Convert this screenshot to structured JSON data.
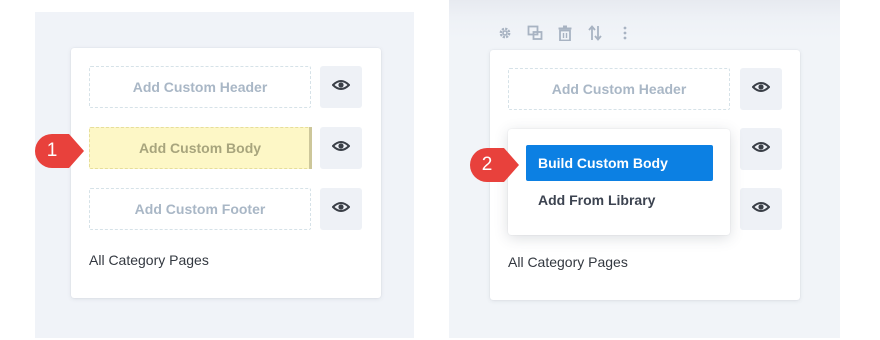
{
  "left": {
    "slots": {
      "header": "Add Custom Header",
      "body": "Add Custom Body",
      "footer": "Add Custom Footer"
    },
    "footer_label": "All Category Pages",
    "step_badge": "1"
  },
  "right": {
    "toolbar_icons": [
      "gear-icon",
      "duplicate-icon",
      "trash-icon",
      "sort-icon",
      "more-icon"
    ],
    "slots": {
      "header": "Add Custom Header"
    },
    "dropdown": {
      "items": [
        "Build Custom Body",
        "Add From Library"
      ],
      "active_index": 0
    },
    "footer_label": "All Category Pages",
    "step_badge": "2"
  },
  "colors": {
    "accent_blue": "#0c80e3",
    "badge_red": "#e8413c",
    "highlight_yellow": "#fdf7c6",
    "panel_bg": "#f0f3f8"
  }
}
